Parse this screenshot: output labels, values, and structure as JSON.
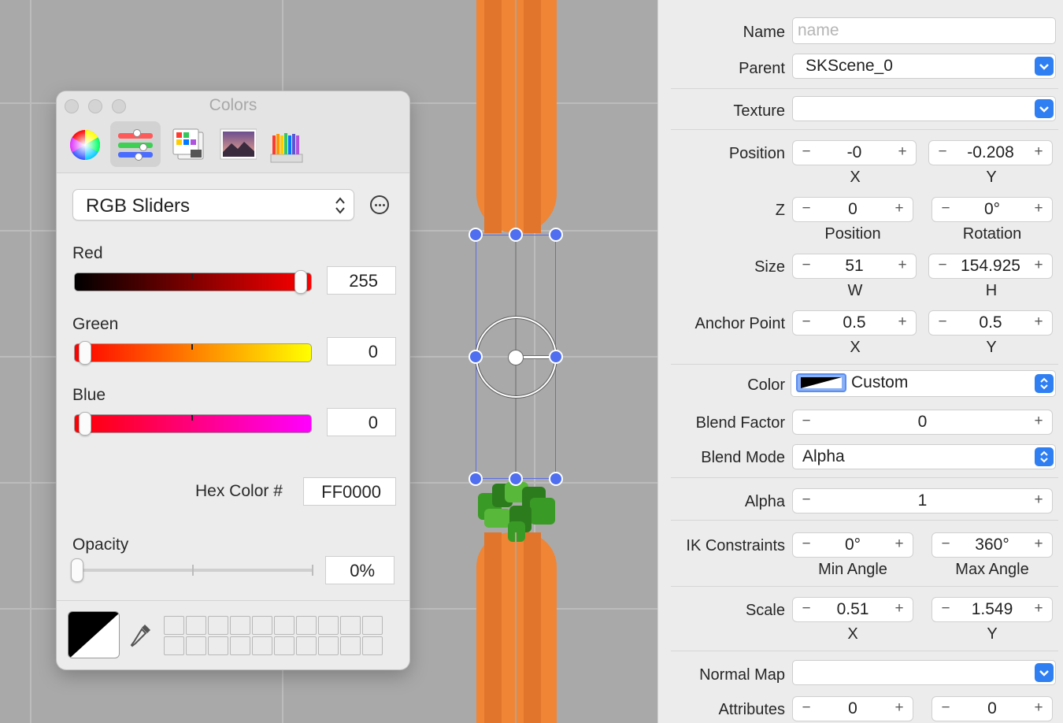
{
  "colors_panel": {
    "title": "Colors",
    "mode_popup": "RGB Sliders",
    "red": {
      "label": "Red",
      "value": "255",
      "level": 1.0
    },
    "green": {
      "label": "Green",
      "value": "0",
      "level": 0.0
    },
    "blue": {
      "label": "Blue",
      "value": "0",
      "level": 0.0
    },
    "hex_label": "Hex Color #",
    "hex_value": "FF0000",
    "opacity_label": "Opacity",
    "opacity_value": "0%",
    "colors_hex": {
      "red": "#ff0000",
      "accent": "#2f7ff3"
    }
  },
  "inspector": {
    "name": {
      "label": "Name",
      "placeholder": "name"
    },
    "parent": {
      "label": "Parent",
      "value": "SKScene_0"
    },
    "texture": {
      "label": "Texture",
      "value": ""
    },
    "position": {
      "label": "Position",
      "x": "-0",
      "y": "-0.208",
      "x_label": "X",
      "y_label": "Y"
    },
    "z": {
      "label": "Z",
      "position": "0",
      "rotation": "0°",
      "position_label": "Position",
      "rotation_label": "Rotation"
    },
    "size": {
      "label": "Size",
      "w": "51",
      "h": "154.925",
      "w_label": "W",
      "h_label": "H"
    },
    "anchor": {
      "label": "Anchor Point",
      "x": "0.5",
      "y": "0.5",
      "x_label": "X",
      "y_label": "Y"
    },
    "color": {
      "label": "Color",
      "value": "Custom"
    },
    "blend_factor": {
      "label": "Blend Factor",
      "value": "0"
    },
    "blend_mode": {
      "label": "Blend Mode",
      "value": "Alpha"
    },
    "alpha": {
      "label": "Alpha",
      "value": "1"
    },
    "ik": {
      "label": "IK Constraints",
      "min": "0°",
      "max": "360°",
      "min_label": "Min Angle",
      "max_label": "Max Angle"
    },
    "scale": {
      "label": "Scale",
      "x": "0.51",
      "y": "1.549",
      "x_label": "X",
      "y_label": "Y"
    },
    "normal_map": {
      "label": "Normal Map",
      "value": ""
    },
    "attributes": {
      "label": "Attributes",
      "a": "0",
      "b": "0"
    },
    "minus_glyph": "−",
    "plus_glyph": "+"
  }
}
